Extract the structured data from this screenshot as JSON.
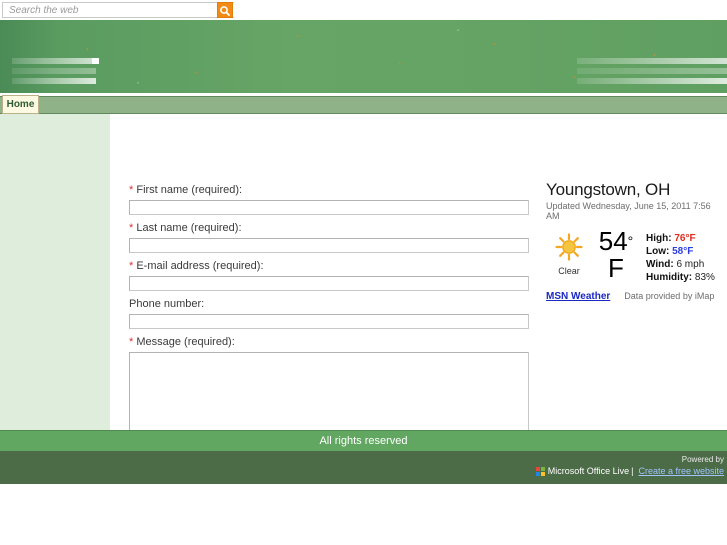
{
  "search": {
    "placeholder": "Search the web",
    "value": "",
    "button_icon": "search-icon"
  },
  "nav": {
    "tabs": [
      {
        "label": "Home",
        "active": true
      }
    ]
  },
  "form": {
    "fields": [
      {
        "label": "First name (required):",
        "required": true,
        "type": "text",
        "value": ""
      },
      {
        "label": "Last name (required):",
        "required": true,
        "type": "text",
        "value": ""
      },
      {
        "label": "E-mail address (required):",
        "required": true,
        "type": "text",
        "value": ""
      },
      {
        "label": "Phone number:",
        "required": false,
        "type": "text",
        "value": ""
      },
      {
        "label": "Message (required):",
        "required": true,
        "type": "textarea",
        "value": ""
      }
    ],
    "required_marker": "*"
  },
  "weather": {
    "city": "Youngstown, OH",
    "updated": "Updated Wednesday, June 15, 2011 7:56 AM",
    "condition": "Clear",
    "condition_icon": "sun-icon",
    "temperature": "54",
    "degree_symbol": "°",
    "unit": "F",
    "details": [
      {
        "label": "High:",
        "value": "76°F",
        "color": "#e02b1d"
      },
      {
        "label": "Low:",
        "value": "58°F",
        "color": "#2b3ce0"
      },
      {
        "label": "Wind:",
        "value": "6 mph",
        "color": "#222222"
      },
      {
        "label": "Humidity:",
        "value": "83%",
        "color": "#222222"
      }
    ],
    "link_label": "MSN Weather",
    "credit": "Data provided by iMap"
  },
  "footer": {
    "rights": "All rights reserved",
    "powered_by": "Powered by",
    "brand": "Microsoft Office Live",
    "separator": "|",
    "cta": "Create a free website"
  },
  "colors": {
    "banner_green": "#67a566",
    "nav_green": "#8fb289",
    "footer_green": "#62a761",
    "footer_dark": "#4c6b47",
    "sidebar_green": "#dfeddd",
    "tab_cream": "#fdf9e3",
    "search_orange": "#f28b14"
  }
}
